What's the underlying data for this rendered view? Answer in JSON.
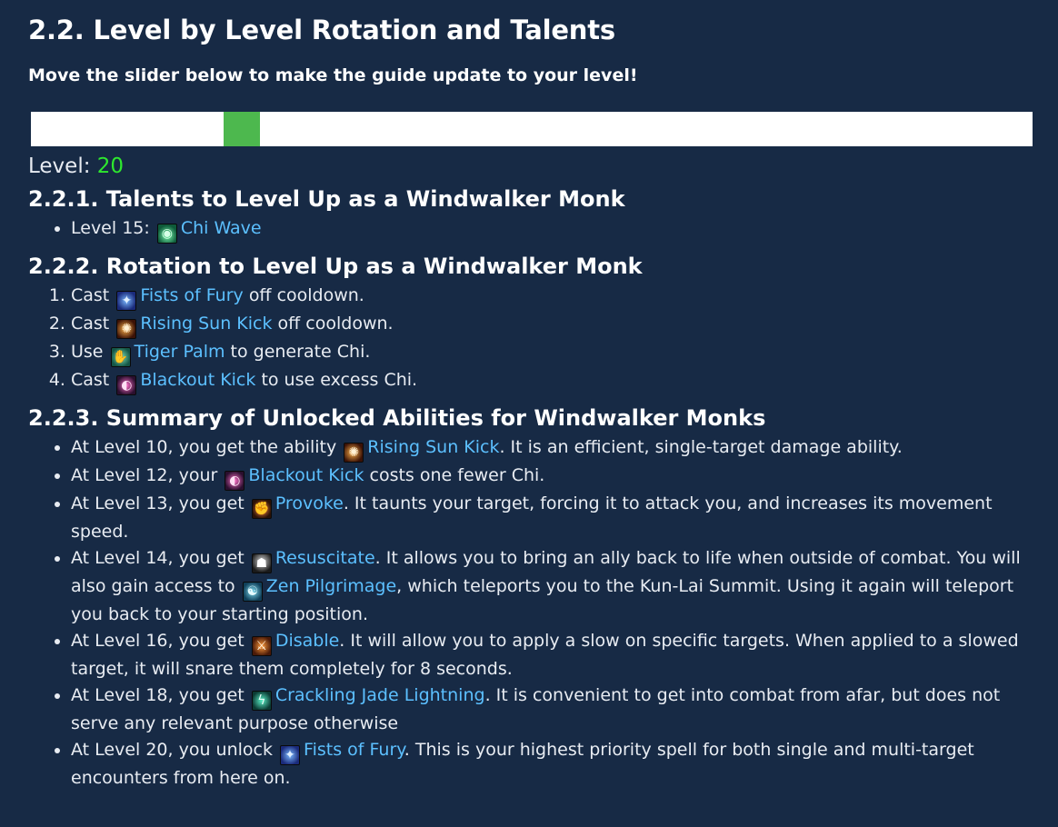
{
  "section": {
    "title": "2.2. Level by Level Rotation and Talents",
    "intro": "Move the slider below to make the guide update to your level!"
  },
  "slider": {
    "level_label": "Level:",
    "level_value": "20",
    "level_min": 10,
    "level_max": 60
  },
  "talents": {
    "title": "2.2.1. Talents to Level Up as a Windwalker Monk",
    "items": [
      {
        "prefix": "Level 15:",
        "icon": "chi-wave-icon",
        "link": "Chi Wave"
      }
    ]
  },
  "rotation": {
    "title": "2.2.2. Rotation to Level Up as a Windwalker Monk",
    "items": [
      {
        "before": "Cast",
        "icon": "fists-of-fury-icon",
        "link": "Fists of Fury",
        "after": "off cooldown."
      },
      {
        "before": "Cast",
        "icon": "rising-sun-kick-icon",
        "link": "Rising Sun Kick",
        "after": "off cooldown."
      },
      {
        "before": "Use",
        "icon": "tiger-palm-icon",
        "link": "Tiger Palm",
        "after": "to generate Chi."
      },
      {
        "before": "Cast",
        "icon": "blackout-kick-icon",
        "link": "Blackout Kick",
        "after": "to use excess Chi."
      }
    ]
  },
  "summary": {
    "title": "2.2.3. Summary of Unlocked Abilities for Windwalker Monks",
    "items": [
      {
        "before": "At Level 10, you get the ability",
        "icon": "rising-sun-kick-icon",
        "link": "Rising Sun Kick",
        "after": ". It is an efficient, single-target damage ability."
      },
      {
        "before": "At Level 12, your",
        "icon": "blackout-kick-icon",
        "link": "Blackout Kick",
        "after": "costs one fewer Chi."
      },
      {
        "before": "At Level 13, you get",
        "icon": "provoke-icon",
        "link": "Provoke",
        "after": ". It taunts your target, forcing it to attack you, and increases its movement speed."
      },
      {
        "before": "At Level 14, you get",
        "icon": "resuscitate-icon",
        "link": "Resuscitate",
        "after": ". It allows you to bring an ally back to life when outside of combat. You will also gain access to",
        "icon2": "zen-pilgrimage-icon",
        "link2": "Zen Pilgrimage",
        "after2": ", which teleports you to the Kun-Lai Summit. Using it again will teleport you back to your starting position."
      },
      {
        "before": "At Level 16, you get",
        "icon": "disable-icon",
        "link": "Disable",
        "after": ". It will allow you to apply a slow on specific targets. When applied to a slowed target, it will snare them completely for 8 seconds."
      },
      {
        "before": "At Level 18, you get",
        "icon": "crackling-jade-lightning-icon",
        "link": "Crackling Jade Lightning",
        "after": ". It is convenient to get into combat from afar, but does not serve any relevant purpose otherwise"
      },
      {
        "before": "At Level 20, you unlock",
        "icon": "fists-of-fury-icon",
        "link": "Fists of Fury",
        "after": ". This is your highest priority spell for both single and multi-target encounters from here on."
      }
    ]
  }
}
